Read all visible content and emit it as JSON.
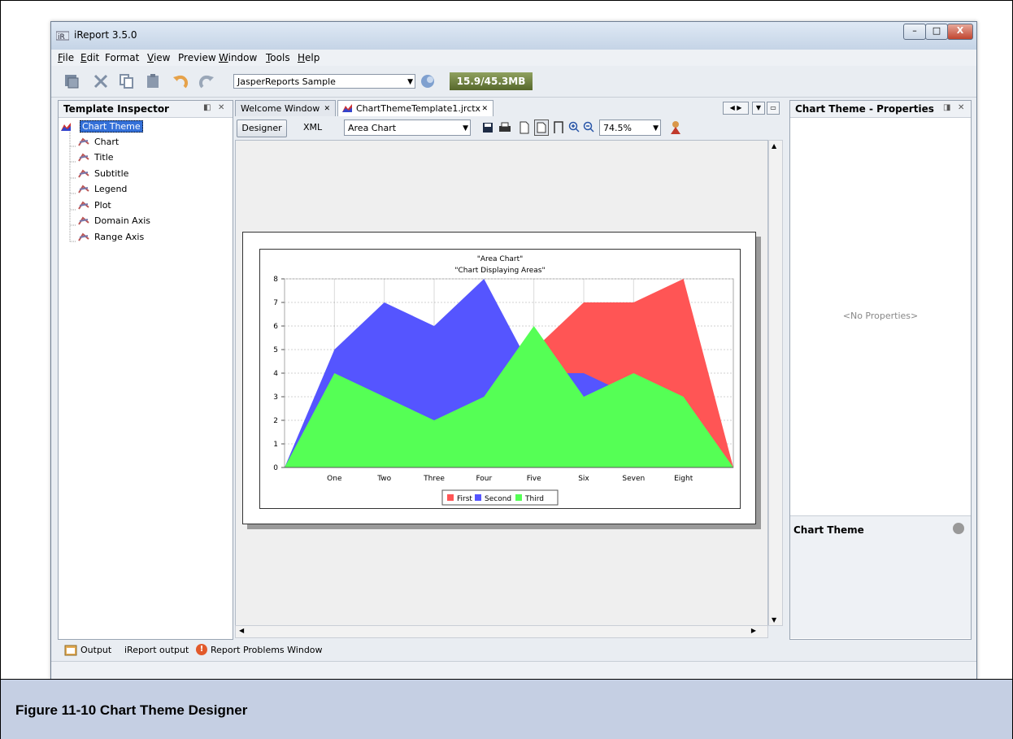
{
  "app": {
    "title": "iReport 3.5.0"
  },
  "window_controls": {
    "minimize": "–",
    "maximize": "□",
    "close": "X"
  },
  "menu": [
    {
      "mnemonic": "F",
      "rest": "ile"
    },
    {
      "mnemonic": "E",
      "rest": "dit"
    },
    {
      "mnemonic": "",
      "rest": "Format"
    },
    {
      "mnemonic": "V",
      "rest": "iew"
    },
    {
      "mnemonic": "",
      "rest": "Preview"
    },
    {
      "mnemonic": "W",
      "rest": "indow"
    },
    {
      "mnemonic": "T",
      "rest": "ools"
    },
    {
      "mnemonic": "H",
      "rest": "elp"
    }
  ],
  "toolbar": {
    "datasource": "JasperReports Sample",
    "memory": "15.9/45.3MB"
  },
  "template_inspector": {
    "title": "Template Inspector",
    "root": "Chart Theme",
    "items": [
      "Chart",
      "Title",
      "Subtitle",
      "Legend",
      "Plot",
      "Domain Axis",
      "Range Axis"
    ]
  },
  "editor": {
    "tabs": [
      {
        "label": "Welcome Window"
      },
      {
        "label": "ChartThemeTemplate1.jrctx"
      }
    ],
    "designer_label": "Designer",
    "xml_label": "XML",
    "chart_type": "Area Chart",
    "zoom": "74.5%"
  },
  "properties": {
    "title": "Chart Theme - Properties",
    "empty_text": "<No Properties>",
    "help_title": "Chart Theme"
  },
  "bottom_tabs": {
    "output": "Output",
    "ireport_output": "iReport output",
    "problems": "Report Problems Window"
  },
  "caption": "Figure 11-10  Chart Theme Designer",
  "chart_data": {
    "type": "area",
    "title": "\"Area Chart\"",
    "subtitle": "\"Chart Displaying Areas\"",
    "categories": [
      "One",
      "Two",
      "Three",
      "Four",
      "Five",
      "Six",
      "Seven",
      "Eight"
    ],
    "ylim": [
      0,
      8
    ],
    "yticks": [
      "0",
      "1",
      "2",
      "3",
      "4",
      "5",
      "6",
      "7",
      "8"
    ],
    "grid": true,
    "legend_position": "bottom",
    "series": [
      {
        "name": "First",
        "color": "#ff5555",
        "values": [
          4,
          3,
          2,
          3,
          5,
          7,
          7,
          8
        ]
      },
      {
        "name": "Second",
        "color": "#5555ff",
        "values": [
          5,
          7,
          6,
          8,
          4,
          4,
          3,
          1
        ]
      },
      {
        "name": "Third",
        "color": "#55ff55",
        "values": [
          4,
          3,
          2,
          3,
          6,
          3,
          4,
          3
        ]
      }
    ]
  }
}
